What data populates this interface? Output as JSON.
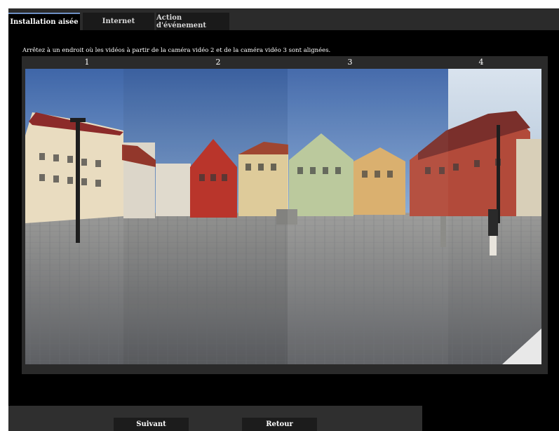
{
  "tabs": [
    {
      "label": "Installation aisée",
      "active": true
    },
    {
      "label": "Internet",
      "active": false
    },
    {
      "label": "Action d'événement",
      "active": false
    }
  ],
  "instruction": "Arrêtez à un endroit où les vidéos à partir de la caméra vidéo 2 et de la caméra vidéo 3 sont alignées.",
  "camera_labels": [
    "1",
    "2",
    "3",
    "4"
  ],
  "buttons": {
    "next_label": "Suivant",
    "back_label": "Retour"
  },
  "colors": {
    "tab_active_accent": "#6e90c4",
    "background": "#000000",
    "panel": "#2a2a2a"
  }
}
